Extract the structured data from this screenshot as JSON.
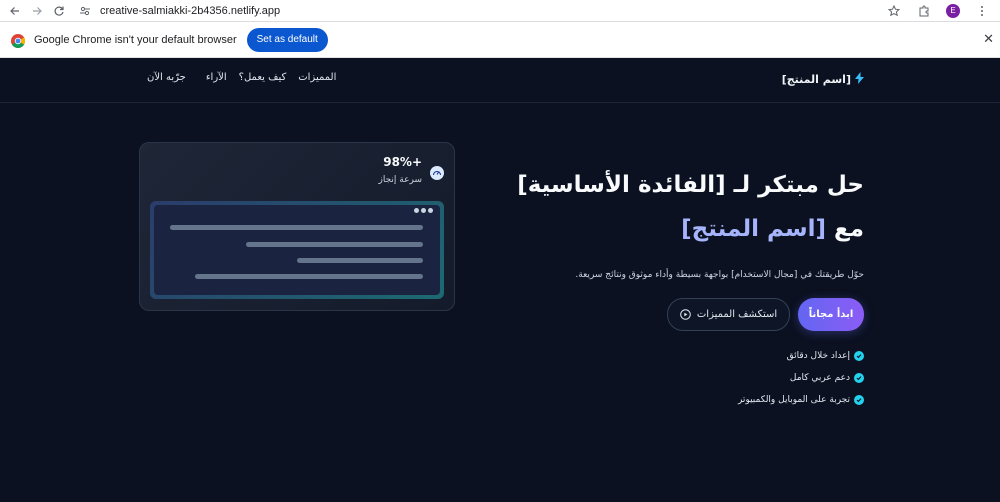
{
  "browser": {
    "url": "creative-salmiakki-2b4356.netlify.app",
    "profile_initial": "E",
    "infobar_message": "Google Chrome isn't your default browser",
    "set_default_label": "Set as default",
    "close_glyph": "✕"
  },
  "nav": {
    "brand_icon": "bolt-icon",
    "brand": "[اسم المنتج]",
    "links": [
      "المميزات",
      "كيف يعمل؟",
      "الآراء",
      "جرّبه الآن"
    ]
  },
  "hero": {
    "title_line1": "حل مبتكر لـ [الفائدة الأساسية]",
    "title_line2_prefix": "مع ",
    "title_line2_accent": "[اسم المنتج]",
    "subtitle": "حوّل طريقتك في [مجال الاستخدام] بواجهة بسيطة وأداء موثوق ونتائج سريعة.",
    "primary_cta": "ابدأ مجاناً",
    "secondary_cta": "استكشف المميزات",
    "features": [
      "إعداد خلال دقائق",
      "دعم عربي كامل",
      "تجربة على الموبايل والكمبيوتر"
    ]
  },
  "card": {
    "stat_value": "98%+",
    "stat_label": "سرعة إنجاز"
  },
  "colors": {
    "page_bg": "#0b1120",
    "accent_text": "#a5b4fc",
    "primary_gradient_start": "#6366f1",
    "primary_gradient_end": "#8b5cf6",
    "check": "#22d3ee",
    "chrome_button": "#0b57d0"
  }
}
